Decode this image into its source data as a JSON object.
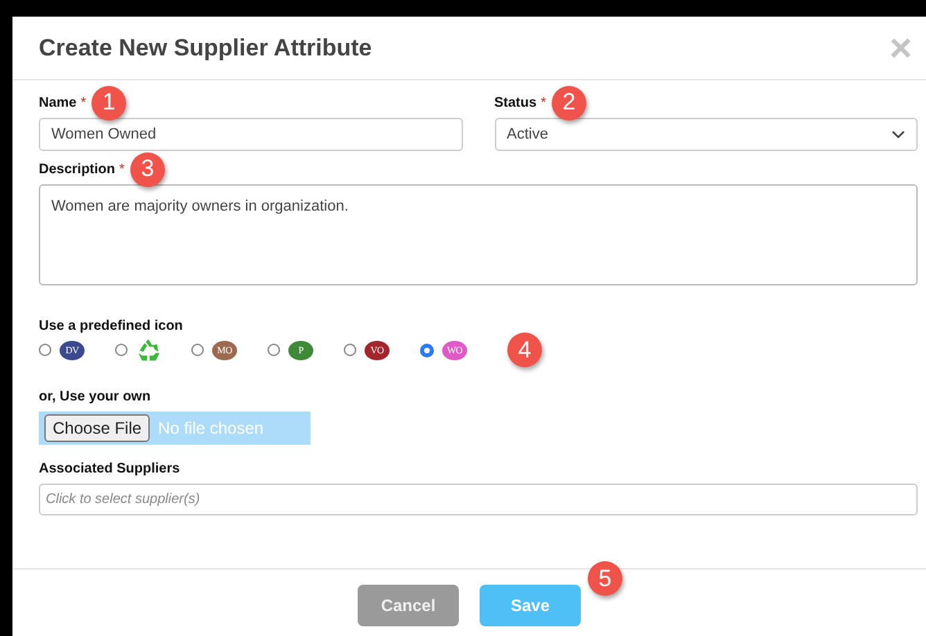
{
  "dialog": {
    "title": "Create New Supplier Attribute",
    "close": "×"
  },
  "name_field": {
    "label": "Name",
    "required_mark": "*",
    "value": "Women Owned",
    "callout": "1"
  },
  "status_field": {
    "label": "Status",
    "required_mark": "*",
    "value": "Active",
    "callout": "2"
  },
  "description_field": {
    "label": "Description",
    "required_mark": "*",
    "value": "Women are majority owners in organization.",
    "callout": "3"
  },
  "predefined_icons": {
    "label": "Use a predefined icon",
    "callout": "4",
    "options": [
      {
        "kind": "letters",
        "text": "DV",
        "color": "#3b4a8e",
        "selected": false
      },
      {
        "kind": "recycle",
        "color": "#3cb83a",
        "selected": false
      },
      {
        "kind": "letters",
        "text": "MO",
        "color": "#9c6a4f",
        "selected": false
      },
      {
        "kind": "letters",
        "text": "P",
        "color": "#3e8a39",
        "selected": false
      },
      {
        "kind": "letters",
        "text": "VO",
        "color": "#a3262c",
        "selected": false
      },
      {
        "kind": "letters",
        "text": "WO",
        "color": "#df5ac8",
        "selected": true
      }
    ]
  },
  "own_icon": {
    "label": "or, Use your own",
    "button": "Choose File",
    "status": "No file chosen"
  },
  "suppliers_field": {
    "label": "Associated Suppliers",
    "placeholder": "Click to select supplier(s)"
  },
  "footer": {
    "buttons": [
      {
        "label": "Cancel",
        "kind": "secondary"
      },
      {
        "label": "Save",
        "kind": "primary"
      }
    ],
    "callout": "5"
  }
}
